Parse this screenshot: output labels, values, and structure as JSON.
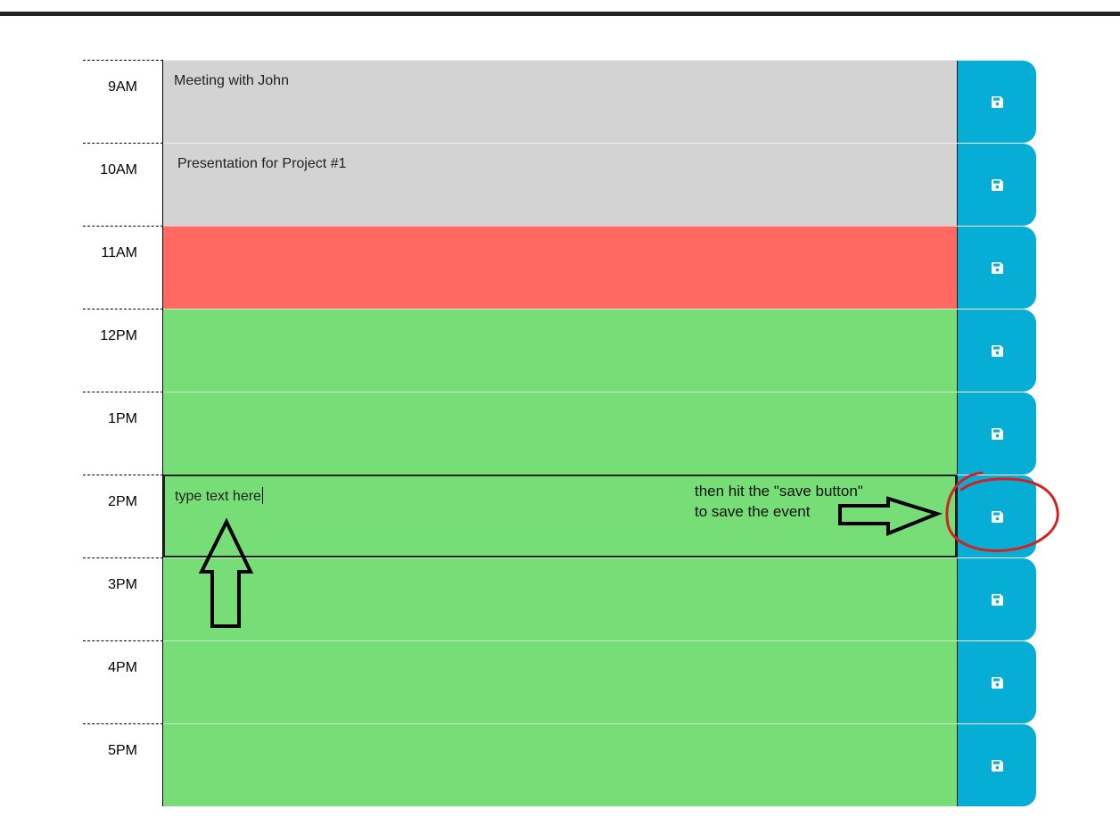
{
  "rows": [
    {
      "hour": "9AM",
      "state": "past",
      "text": "Meeting with John"
    },
    {
      "hour": "10AM",
      "state": "past",
      "text": "Presentation for Project #1"
    },
    {
      "hour": "11AM",
      "state": "present",
      "text": ""
    },
    {
      "hour": "12PM",
      "state": "future",
      "text": ""
    },
    {
      "hour": "1PM",
      "state": "future",
      "text": ""
    },
    {
      "hour": "2PM",
      "state": "future",
      "text": "type text here"
    },
    {
      "hour": "3PM",
      "state": "future",
      "text": ""
    },
    {
      "hour": "4PM",
      "state": "future",
      "text": ""
    },
    {
      "hour": "5PM",
      "state": "future",
      "text": ""
    }
  ],
  "annotation": {
    "line1": "then hit the \"save button\"",
    "line2": "to save the event"
  },
  "icons": {
    "save": "floppy-disk-icon",
    "arrow_up": "arrow-up-icon",
    "arrow_right": "arrow-right-icon"
  },
  "colors": {
    "past": "#d3d3d3",
    "present": "#ff6961",
    "future": "#77dd77",
    "save_button": "#06aed5",
    "highlight_circle": "#d62020"
  }
}
